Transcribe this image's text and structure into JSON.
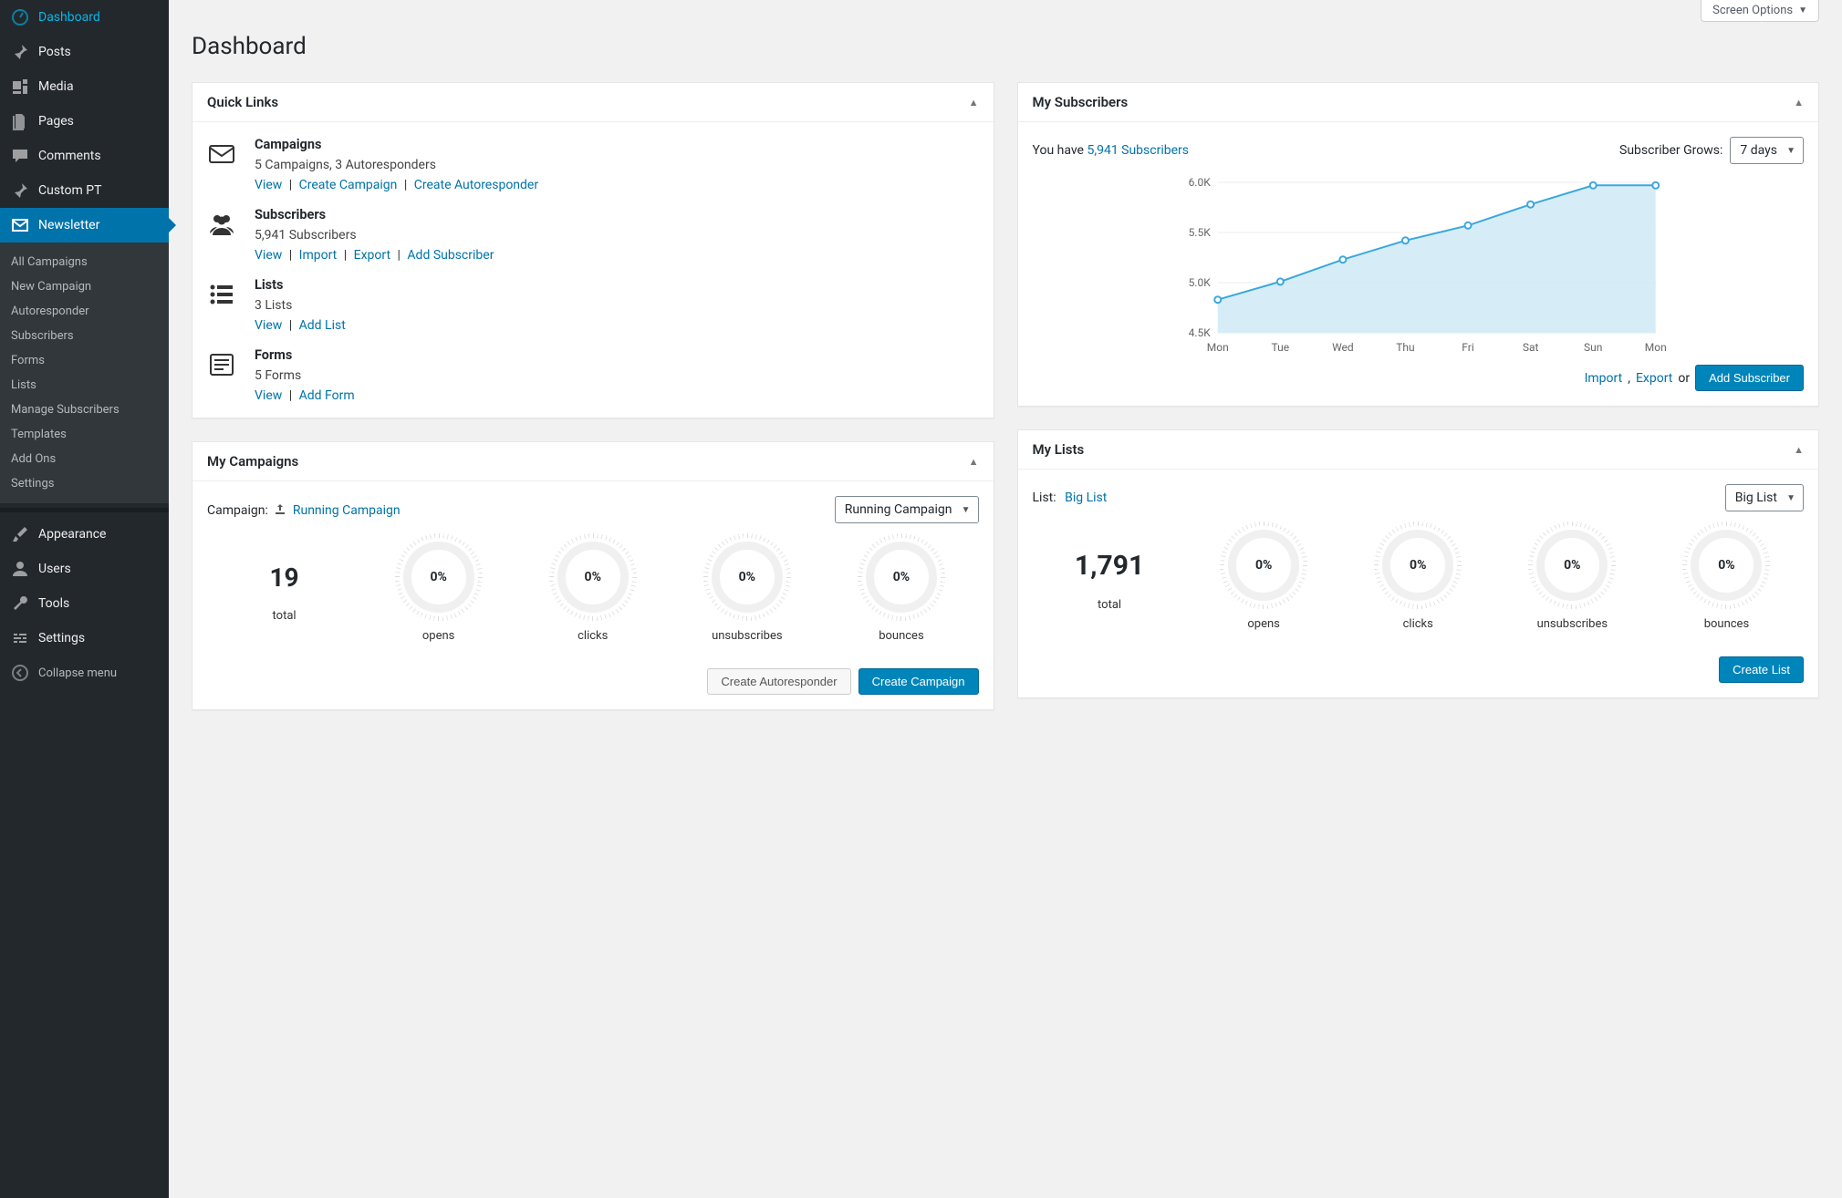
{
  "header": {
    "screen_options": "Screen Options",
    "page_title": "Dashboard"
  },
  "sidebar": {
    "main": [
      {
        "name": "dashboard",
        "label": "Dashboard",
        "icon": "dashboard"
      },
      {
        "name": "posts",
        "label": "Posts",
        "icon": "pin"
      },
      {
        "name": "media",
        "label": "Media",
        "icon": "media"
      },
      {
        "name": "pages",
        "label": "Pages",
        "icon": "pages"
      },
      {
        "name": "comments",
        "label": "Comments",
        "icon": "comment"
      },
      {
        "name": "custom-pt",
        "label": "Custom PT",
        "icon": "pin"
      },
      {
        "name": "newsletter",
        "label": "Newsletter",
        "icon": "mail",
        "active": true
      }
    ],
    "sub": [
      "All Campaigns",
      "New Campaign",
      "Autoresponder",
      "Subscribers",
      "Forms",
      "Lists",
      "Manage Subscribers",
      "Templates",
      "Add Ons",
      "Settings"
    ],
    "lower": [
      {
        "name": "appearance",
        "label": "Appearance",
        "icon": "brush"
      },
      {
        "name": "users",
        "label": "Users",
        "icon": "user"
      },
      {
        "name": "tools",
        "label": "Tools",
        "icon": "wrench"
      },
      {
        "name": "settings",
        "label": "Settings",
        "icon": "sliders"
      }
    ],
    "collapse": "Collapse menu"
  },
  "quicklinks": {
    "title": "Quick Links",
    "items": [
      {
        "icon": "envelope",
        "heading": "Campaigns",
        "sub": "5 Campaigns, 3 Autoresponders",
        "links": [
          "View",
          "Create Campaign",
          "Create Autoresponder"
        ]
      },
      {
        "icon": "users",
        "heading": "Subscribers",
        "sub": "5,941 Subscribers",
        "links": [
          "View",
          "Import",
          "Export",
          "Add Subscriber"
        ]
      },
      {
        "icon": "list",
        "heading": "Lists",
        "sub": "3 Lists",
        "links": [
          "View",
          "Add List"
        ]
      },
      {
        "icon": "form",
        "heading": "Forms",
        "sub": "5 Forms",
        "links": [
          "View",
          "Add Form"
        ]
      }
    ]
  },
  "campaigns": {
    "title": "My Campaigns",
    "selector_label": "Campaign:",
    "selector_link": "Running Campaign",
    "select_value": "Running Campaign",
    "total": "19",
    "stats": [
      {
        "value": "0%",
        "label": "opens"
      },
      {
        "value": "0%",
        "label": "clicks"
      },
      {
        "value": "0%",
        "label": "unsubscribes"
      },
      {
        "value": "0%",
        "label": "bounces"
      }
    ],
    "total_label": "total",
    "btn_autoresponder": "Create Autoresponder",
    "btn_campaign": "Create Campaign"
  },
  "subscribers": {
    "title": "My Subscribers",
    "text_prefix": "You have ",
    "count_link": "5,941 Subscribers",
    "grows_label": "Subscriber Grows:",
    "grows_select": "7 days",
    "import": "Import",
    "export": "Export",
    "or": " or ",
    "add_btn": "Add Subscriber"
  },
  "chart_data": {
    "type": "line",
    "categories": [
      "Mon",
      "Tue",
      "Wed",
      "Thu",
      "Fri",
      "Sat",
      "Sun",
      "Mon"
    ],
    "values": [
      4830,
      5010,
      5230,
      5420,
      5570,
      5780,
      5970,
      5970
    ],
    "ylabel": "",
    "ylim": [
      4500,
      6000
    ],
    "yticks": [
      "4.5K",
      "5.0K",
      "5.5K",
      "6.0K"
    ]
  },
  "lists": {
    "title": "My Lists",
    "selector_label": "List:",
    "selector_link": "Big List",
    "select_value": "Big List",
    "total": "1,791",
    "stats": [
      {
        "value": "0%",
        "label": "opens"
      },
      {
        "value": "0%",
        "label": "clicks"
      },
      {
        "value": "0%",
        "label": "unsubscribes"
      },
      {
        "value": "0%",
        "label": "bounces"
      }
    ],
    "total_label": "total",
    "btn_create": "Create List"
  }
}
